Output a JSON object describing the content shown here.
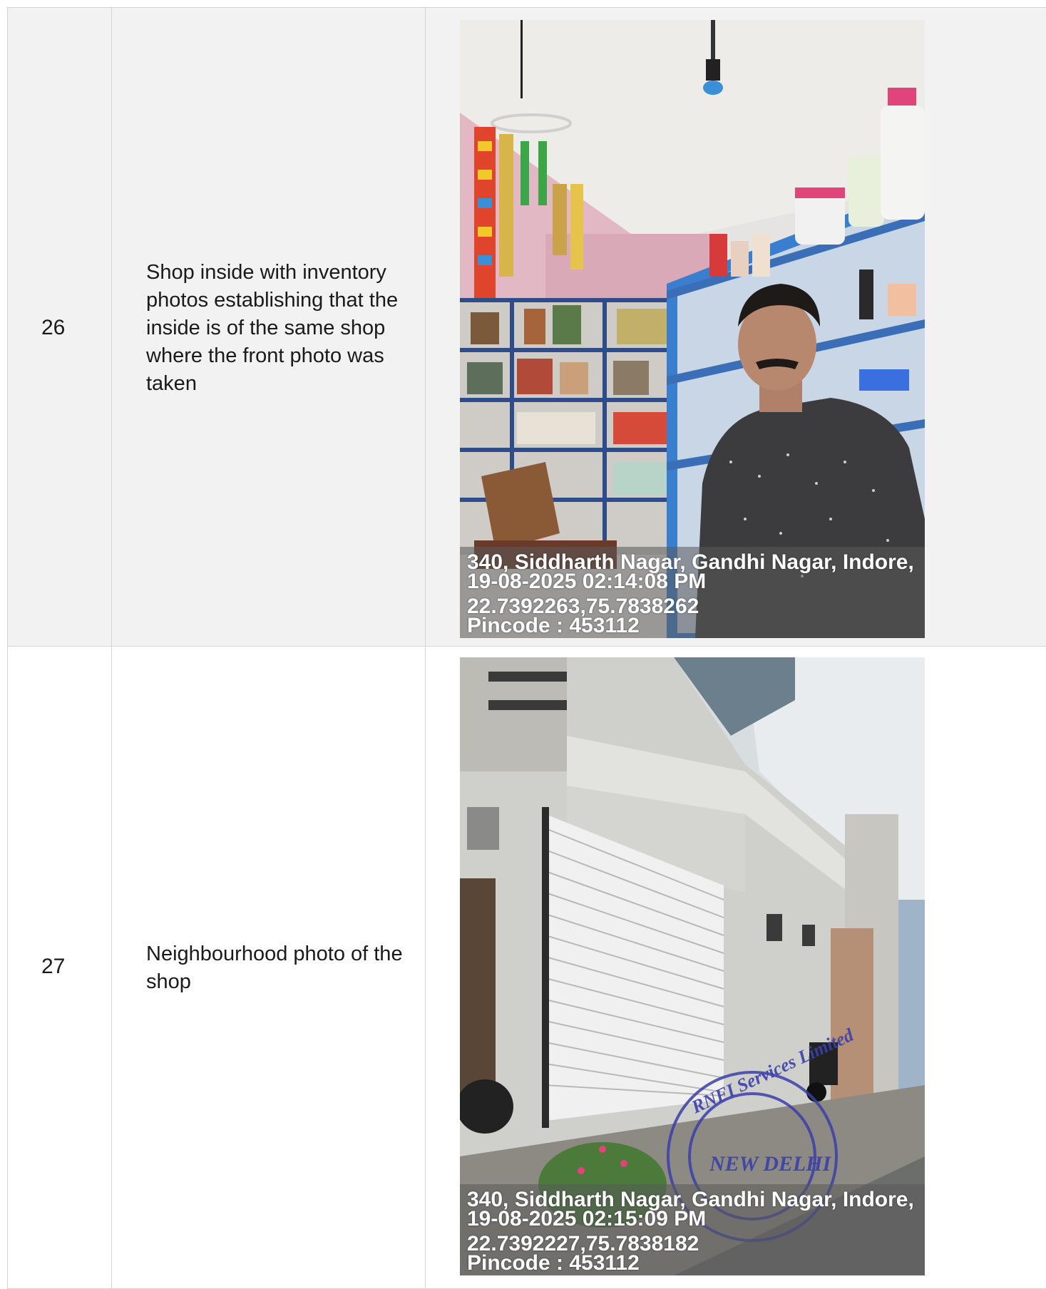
{
  "rows": [
    {
      "number": "26",
      "description": "Shop inside with inventory photos establishing that the inside is of the same shop where the front photo was taken",
      "photo": {
        "subject": "shop-interior-with-shopkeeper",
        "stamp": {
          "address": "340, Siddharth Nagar, Gandhi Nagar, Indore,",
          "datetime": "19-08-2025 02:14:08 PM",
          "coordinates": "22.7392263,75.7838262",
          "pincode": "Pincode : 453112"
        }
      }
    },
    {
      "number": "27",
      "description": "Neighbourhood photo of the shop",
      "photo": {
        "subject": "shop-exterior-with-shutter",
        "seal_text": [
          "RNFI Services Limited",
          "NEW DELHI"
        ],
        "stamp": {
          "address": "340, Siddharth Nagar, Gandhi Nagar, Indore,",
          "datetime": "19-08-2025 02:15:09 PM",
          "coordinates": "22.7392227,75.7838182",
          "pincode": "Pincode : 453112"
        }
      }
    }
  ],
  "colors": {
    "row_shaded": "#f2f2f2",
    "row_plain": "#ffffff",
    "border": "#d4d4d4",
    "text": "#1a1a1a",
    "seal_blue": "#3b3fa8"
  }
}
